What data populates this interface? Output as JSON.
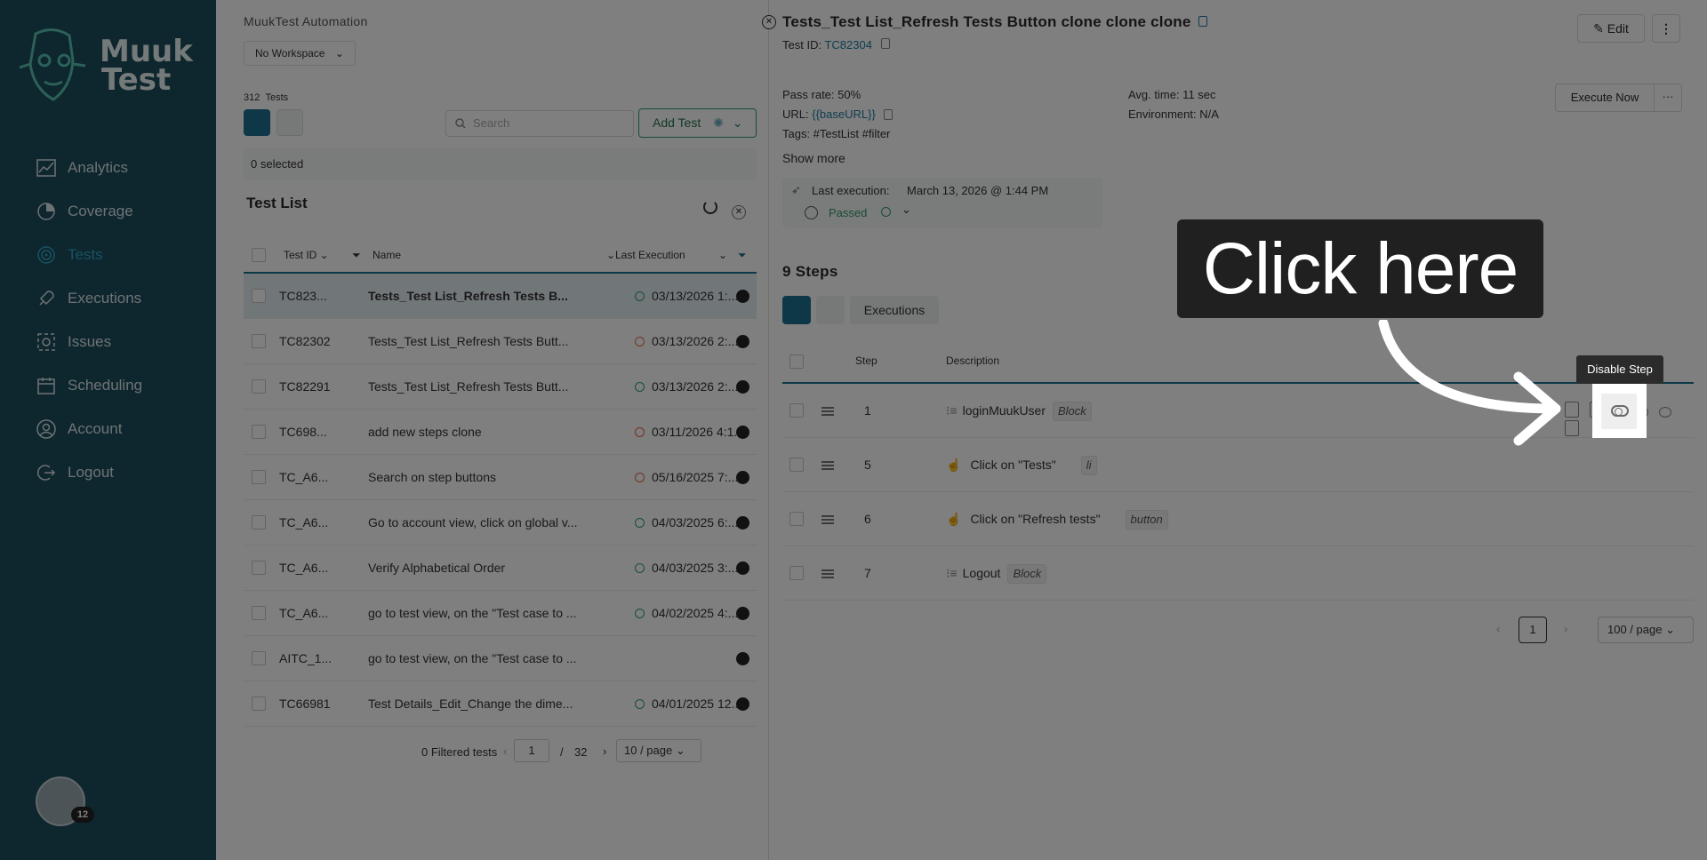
{
  "brand": {
    "logo_line1": "Muuk",
    "logo_line2": "Test"
  },
  "sidebar": {
    "items": [
      {
        "label": "Analytics",
        "icon": "chart-icon",
        "active": false
      },
      {
        "label": "Coverage",
        "icon": "coverage-icon",
        "active": false
      },
      {
        "label": "Tests",
        "icon": "target-icon",
        "active": true
      },
      {
        "label": "Executions",
        "icon": "rocket-icon",
        "active": false
      },
      {
        "label": "Issues",
        "icon": "bug-icon",
        "active": false
      },
      {
        "label": "Scheduling",
        "icon": "calendar-icon",
        "active": false
      },
      {
        "label": "Account",
        "icon": "user-icon",
        "active": false
      },
      {
        "label": "Logout",
        "icon": "logout-icon",
        "active": false
      }
    ],
    "notification_count": "12"
  },
  "list": {
    "company": "MuukTest Automation",
    "workspace": "No Workspace",
    "tests_count": "312",
    "tests_label": "Tests",
    "search_placeholder": "Search",
    "add_test": "Add Test",
    "selected": "0 selected",
    "title": "Test List",
    "headers": {
      "id": "Test ID",
      "name": "Name",
      "last_execution": "Last Execution"
    },
    "rows": [
      {
        "id": "TC823...",
        "name": "Tests_Test List_Refresh Tests B...",
        "exec": "03/13/2026 1:...",
        "status": "pass",
        "selected": true,
        "bold": true
      },
      {
        "id": "TC82302",
        "name": "Tests_Test List_Refresh Tests Butt...",
        "exec": "03/13/2026 2:...",
        "status": "warn",
        "selected": false,
        "bold": false
      },
      {
        "id": "TC82291",
        "name": "Tests_Test List_Refresh Tests Butt...",
        "exec": "03/13/2026 2:...",
        "status": "pass",
        "selected": false,
        "bold": false
      },
      {
        "id": "TC698...",
        "name": "add new steps clone",
        "exec": "03/11/2026 4:1...",
        "status": "warn",
        "selected": false,
        "bold": false
      },
      {
        "id": "TC_A6...",
        "name": "Search on step buttons",
        "exec": "05/16/2025 7:...",
        "status": "warn",
        "selected": false,
        "bold": false
      },
      {
        "id": "TC_A6...",
        "name": "Go to account view, click on global v...",
        "exec": "04/03/2025 6:...",
        "status": "pass",
        "selected": false,
        "bold": false
      },
      {
        "id": "TC_A6...",
        "name": "Verify Alphabetical Order",
        "exec": "04/03/2025 3:...",
        "status": "pass",
        "selected": false,
        "bold": false
      },
      {
        "id": "TC_A6...",
        "name": "go to test view, on the \"Test case to ...",
        "exec": "04/02/2025 4:...",
        "status": "pass",
        "selected": false,
        "bold": false
      },
      {
        "id": "AITC_1...",
        "name": "go to test view, on the \"Test case to ...",
        "exec": "",
        "status": "",
        "selected": false,
        "bold": false
      },
      {
        "id": "TC66981",
        "name": "Test Details_Edit_Change the dime...",
        "exec": "04/01/2025 12...",
        "status": "pass",
        "selected": false,
        "bold": false
      }
    ],
    "pager": {
      "filtered": "0 Filtered tests",
      "page": "1",
      "sep": "/",
      "total": "32",
      "per_page": "10 / page"
    }
  },
  "detail": {
    "title": "Tests_Test List_Refresh Tests Button clone clone clone",
    "test_id_label": "Test ID:",
    "test_id": "TC82304",
    "edit": "Edit",
    "pass_rate": "Pass rate: 50%",
    "url_label": "URL:",
    "url": "{{baseURL}}",
    "tags": "Tags: #TestList #filter",
    "avg_time": "Avg. time: 11 sec",
    "environment": "Environment: N/A",
    "execute_now": "Execute Now",
    "more": "···",
    "show_more": "Show more",
    "last_execution_label": "Last execution:",
    "last_execution": "March 13, 2026 @ 1:44 PM",
    "status": "Passed",
    "steps_title": "9 Steps",
    "executions_tab": "Executions",
    "steps_headers": {
      "step": "Step",
      "description": "Description"
    },
    "steps": [
      {
        "num": "1",
        "desc": "loginMuukUser",
        "tag": "Block",
        "kind": "block"
      },
      {
        "num": "5",
        "desc": "Click on  \"Tests\"",
        "tag": "li",
        "kind": "click"
      },
      {
        "num": "6",
        "desc": "Click on  \"Refresh tests\"",
        "tag": "button",
        "kind": "click"
      },
      {
        "num": "7",
        "desc": "Logout",
        "tag": "Block",
        "kind": "block"
      }
    ],
    "pager": {
      "page": "1",
      "per_page": "100 / page"
    }
  },
  "overlay": {
    "callout": "Click here",
    "tooltip": "Disable Step"
  },
  "colors": {
    "sidebar": "#1d4d5d",
    "accent": "#1d6f8f",
    "pass": "#2e9c6a",
    "warn": "#e0663a"
  }
}
